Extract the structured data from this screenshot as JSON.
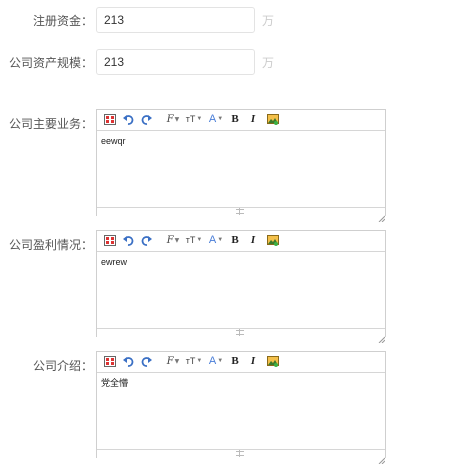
{
  "form": {
    "registered_capital": {
      "label": "注册资金：",
      "value": "213",
      "unit": "万"
    },
    "asset_scale": {
      "label": "公司资产规模：",
      "value": "213",
      "unit": "万"
    },
    "main_business": {
      "label": "公司主要业务：",
      "content": "eewqr"
    },
    "profit": {
      "label": "公司盈利情况：",
      "content": "ewrew"
    },
    "intro": {
      "label": "公司介绍：",
      "content": "党全懵"
    }
  },
  "toolbar": {
    "icons": [
      "source-icon",
      "undo-icon",
      "redo-icon",
      "font-family-icon",
      "font-size-icon",
      "font-color-icon",
      "bold-icon",
      "italic-icon",
      "image-icon"
    ],
    "font_glyph": "F",
    "size_glyph": "тT",
    "color_glyph": "A",
    "bold_glyph": "B",
    "italic_glyph": "I"
  },
  "colors": {
    "label": "#555555",
    "unit": "#cccccc",
    "input_border": "#e3e3e3",
    "editor_border": "#cfcfcf",
    "icon_blue": "#4a7ed8"
  }
}
